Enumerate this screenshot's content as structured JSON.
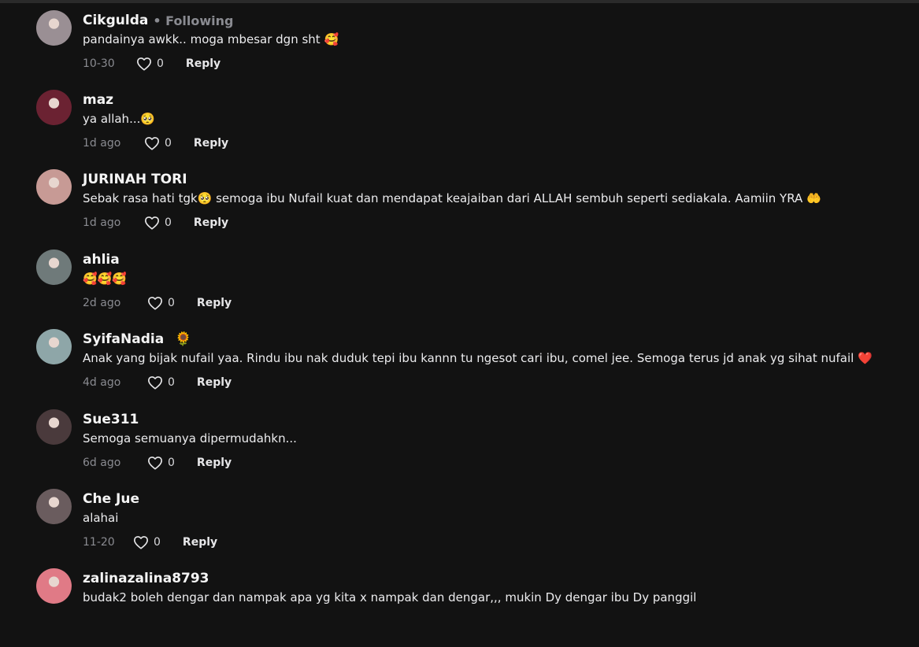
{
  "comments": [
    {
      "name": "Cikgulda",
      "following": "• Following",
      "badge": "",
      "text": "pandainya awkk.. moga mbesar dgn sht 🥰",
      "date": "10-30",
      "likes": "0",
      "reply": "Reply",
      "avatar_color": "#9a8f94"
    },
    {
      "name": "maz",
      "following": "",
      "badge": "",
      "text": "ya allah...🥺",
      "date": "1d ago",
      "likes": "0",
      "reply": "Reply",
      "avatar_color": "#6b2232"
    },
    {
      "name": "JURINAH TORI",
      "following": "",
      "badge": "",
      "text": "Sebak rasa hati tgk🥺  semoga ibu Nufail kuat dan mendapat keajaiban dari ALLAH sembuh seperti sediakala. Aamiin YRA 🤲",
      "date": "1d ago",
      "likes": "0",
      "reply": "Reply",
      "avatar_color": "#c79a95"
    },
    {
      "name": "ahlia",
      "following": "",
      "badge": "",
      "text": "🥰🥰🥰",
      "date": "2d ago",
      "likes": "0",
      "reply": "Reply",
      "avatar_color": "#6f7a7a"
    },
    {
      "name": "SyifaNadia",
      "following": "",
      "badge": "🌻",
      "text": "Anak yang bijak nufail yaa. Rindu ibu nak duduk tepi ibu kannn tu ngesot cari ibu, comel jee. Semoga terus jd anak yg sihat nufail ❤️",
      "date": "4d ago",
      "likes": "0",
      "reply": "Reply",
      "avatar_color": "#8ea6a8"
    },
    {
      "name": "Sue311",
      "following": "",
      "badge": "",
      "text": "Semoga semuanya dipermudahkn...",
      "date": "6d ago",
      "likes": "0",
      "reply": "Reply",
      "avatar_color": "#4a3a3c"
    },
    {
      "name": "Che Jue",
      "following": "",
      "badge": "",
      "text": "alahai",
      "date": "11-20",
      "likes": "0",
      "reply": "Reply",
      "avatar_color": "#6a5c5e"
    },
    {
      "name": "zalinazalina8793",
      "following": "",
      "badge": "",
      "text": "budak2 boleh dengar dan nampak apa yg kita x nampak dan dengar,,, mukin Dy dengar ibu Dy panggil",
      "date": "",
      "likes": "",
      "reply": "",
      "avatar_color": "#e07a86"
    }
  ]
}
